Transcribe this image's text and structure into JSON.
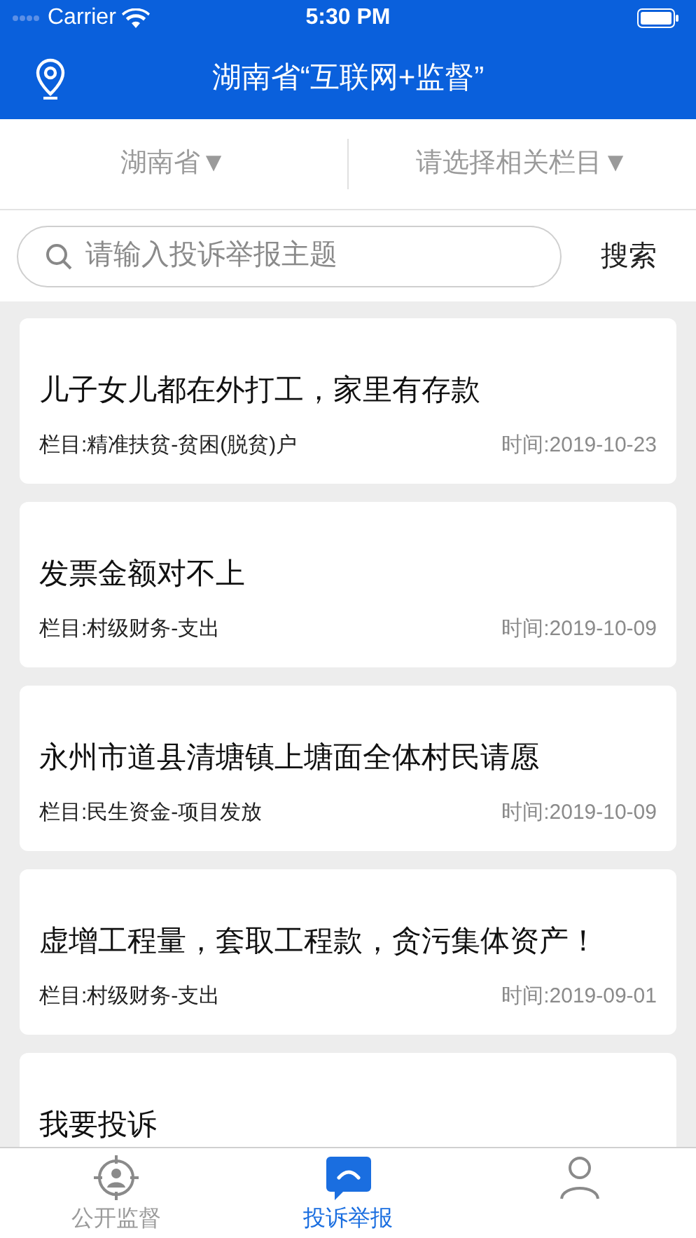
{
  "status_bar": {
    "carrier": "Carrier",
    "time": "5:30 PM"
  },
  "header": {
    "title": "湖南省“互联网+监督”"
  },
  "filters": [
    {
      "label": "湖南省▼"
    },
    {
      "label": "请选择相关栏目▼"
    }
  ],
  "search": {
    "placeholder": "请输入投诉举报主题",
    "button": "搜索"
  },
  "items": [
    {
      "title": "儿子女儿都在外打工，家里有存款",
      "category": "栏目:精准扶贫-贫困(脱贫)户",
      "time": "时间:2019-10-23"
    },
    {
      "title": "发票金额对不上",
      "category": "栏目:村级财务-支出",
      "time": "时间:2019-10-09"
    },
    {
      "title": "永州市道县清塘镇上塘面全体村民请愿",
      "category": "栏目:民生资金-项目发放",
      "time": "时间:2019-10-09"
    },
    {
      "title": "虚增工程量，套取工程款，贪污集体资产！",
      "category": "栏目:村级财务-支出",
      "time": "时间:2019-09-01"
    },
    {
      "title": "我要投诉"
    }
  ],
  "tabs": [
    {
      "kind": "target",
      "label": "公开监督",
      "selected": false
    },
    {
      "kind": "chat",
      "label": "投诉举报",
      "selected": true
    },
    {
      "kind": "person",
      "selected": false
    }
  ]
}
